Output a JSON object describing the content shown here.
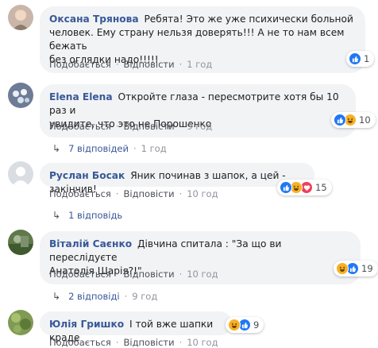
{
  "comments": [
    {
      "author": "Оксана Трянова",
      "text_line1": "Ребята! Это же уже психически больной",
      "text_line2": "человек. Ему страну нельзя доверять!!! А не то нам всем бежать",
      "text_line3": "без оглядки надо!!!!!",
      "like": "Подобається",
      "reply": "Відповісти",
      "time": "1 год",
      "reaction_count": "1"
    },
    {
      "author": "Elena Elena",
      "text_line1": "Откройте глаза - пересмотрите хотя бы 10 раз и",
      "text_line2": "увидите, что это не Порошенко",
      "like": "Подобається",
      "reply": "Відповісти",
      "time": "9 год",
      "reaction_count": "10",
      "replies_label": "7 відповідей",
      "replies_time": "1 год"
    },
    {
      "author": "Руслан Босак",
      "text_line1": "Яник починав з шапок, а цей - закінчив!",
      "like": "Подобається",
      "reply": "Відповісти",
      "time": "10 год",
      "reaction_count": "15",
      "replies_label": "1 відповідь"
    },
    {
      "author": "Віталій Саєнко",
      "text_line1": "Дівчина спитала : \"За що ви переслідуєте",
      "text_line2": "Анатолія Шарія?!\"",
      "like": "Подобається",
      "reply": "Відповісти",
      "time": "10 год",
      "reaction_count": "19",
      "replies_label": "2 відповіді",
      "replies_time": "9 год"
    },
    {
      "author": "Юлія Гришко",
      "text_line1": "І той вже шапки краде",
      "like": "Подобається",
      "reply": "Відповісти",
      "time": "10 год",
      "reaction_count": "9"
    }
  ],
  "colors": {
    "author_link": "#385898",
    "bubble_bg": "#f2f3f5",
    "like_blue": "#2078f4",
    "haha_yellow": "#f7b125",
    "love_red": "#f33e58"
  },
  "icons": {
    "like": "thumbs-up-icon",
    "haha": "laughing-face-icon",
    "love": "heart-icon",
    "reply_arrow": "reply-arrow-icon"
  }
}
